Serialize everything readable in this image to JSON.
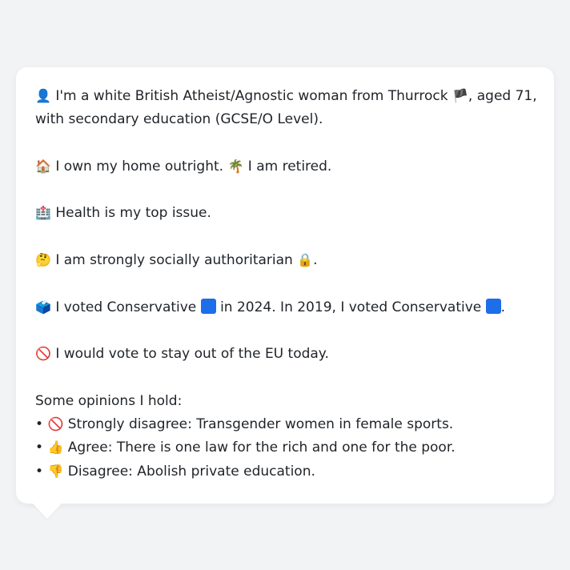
{
  "profile": {
    "intro": {
      "icon": "👤",
      "line1_prefix": "I'm a white British Atheist/Agnostic woman from Thurrock",
      "flag": "🏴",
      "line1_suffix": ", aged 71,",
      "line2": "with secondary education (GCSE/O Level)."
    },
    "home": {
      "icon": "🏠",
      "text1": "I own my home outright.",
      "icon2": "🌴",
      "text2": "I am retired."
    },
    "issue": {
      "icon": "🏥",
      "text": "Health is my top issue."
    },
    "social": {
      "icon": "🤔",
      "text": "I am strongly socially authoritarian",
      "icon2": "🔒",
      "suffix": "."
    },
    "vote": {
      "icon": "🗳️",
      "text1": "I voted Conservative",
      "text2": "in 2024. In 2019, I voted Conservative",
      "suffix": ".",
      "party_color": "#1d6ee8"
    },
    "eu": {
      "icon": "🚫",
      "text": "I would vote to stay out of the EU today."
    },
    "opinions": {
      "heading": "Some opinions I hold:",
      "items": [
        {
          "bullet": "•",
          "icon": "🚫",
          "text": "Strongly disagree: Transgender women in female sports."
        },
        {
          "bullet": "•",
          "icon": "👍",
          "text": "Agree: There is one law for the rich and one for the poor."
        },
        {
          "bullet": "•",
          "icon": "👎",
          "text": "Disagree: Abolish private education."
        }
      ]
    }
  }
}
